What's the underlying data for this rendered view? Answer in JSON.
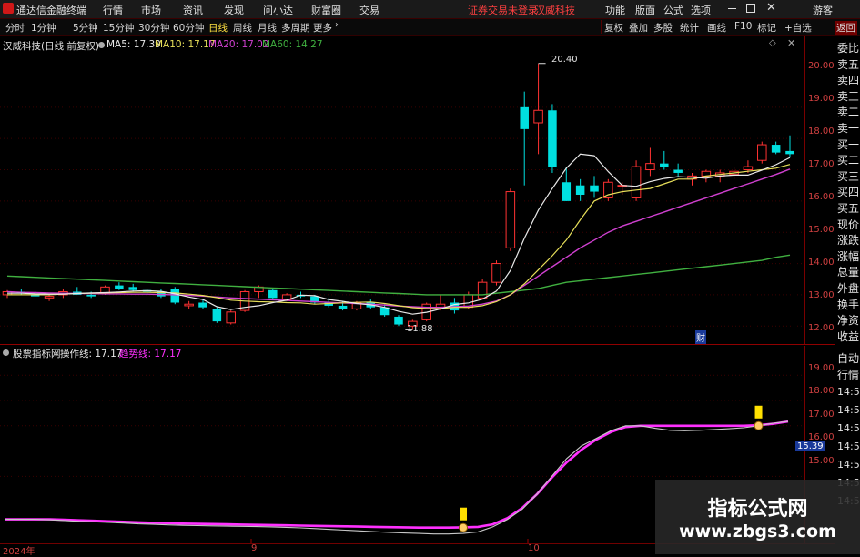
{
  "menubar": {
    "app_title": "通达信金融终端",
    "items": [
      "行情",
      "市场",
      "资讯",
      "发现",
      "问小达",
      "财富圈",
      "交易"
    ],
    "status": "证券交易未登录",
    "stock_name_top": "汉威科技",
    "right_items": [
      "功能",
      "版面",
      "公式",
      "选项"
    ],
    "guest": "游客"
  },
  "toolbar": {
    "periods": [
      "分时",
      "1分钟",
      "5分钟",
      "15分钟",
      "30分钟",
      "60分钟",
      "日线",
      "周线",
      "月线",
      "多周期",
      "更多"
    ],
    "active_period": "日线",
    "right_buttons": [
      "复权",
      "叠加",
      "多股",
      "统计",
      "画线",
      "F10",
      "标记",
      "+自选",
      "返回"
    ]
  },
  "main_chart": {
    "stock_label": "汉威科技(日线 前复权)",
    "ma5": "MA5: 17.39",
    "ma10": "MA10: 17.17",
    "ma20": "MA20: 17.02",
    "ma60": "MA60: 14.27",
    "high_label": "20.40",
    "low_label": "11.88",
    "cai_badge": "财",
    "y_ticks": [
      "20.00",
      "19.00",
      "18.00",
      "17.00",
      "16.00",
      "15.00",
      "14.00",
      "13.00",
      "12.00"
    ]
  },
  "sub_chart": {
    "name": "股票指标网",
    "op_line": "操作线: 17.17",
    "trend_line": "趋势线: 17.17",
    "current_value": "15.39",
    "y_ticks": [
      "19.00",
      "18.00",
      "17.00",
      "16.00",
      "15.00"
    ]
  },
  "side_panel": {
    "quote_items": [
      "委比",
      "卖五",
      "卖四",
      "卖三",
      "卖二",
      "卖一",
      "买一",
      "买二",
      "买三",
      "买四",
      "买五",
      "现价",
      "涨跌",
      "涨幅",
      "总量",
      "外盘",
      "换手",
      "净资",
      "收益"
    ],
    "sub_items": [
      "自动",
      "行情"
    ],
    "time_items": [
      "14:50",
      "14:50",
      "14:50",
      "14:50",
      "14:50",
      "14:50",
      "14:50"
    ]
  },
  "date_axis": {
    "labels": [
      "2024年",
      "9",
      "10"
    ]
  },
  "watermark": {
    "title": "指标公式网",
    "url": "www.zbgs3.com"
  },
  "colors": {
    "up": "#ff3232",
    "down": "#00e0e0",
    "ma5": "#e8e8e8",
    "ma10": "#e8e05a",
    "ma20": "#d040d0",
    "ma60": "#40b040",
    "trend": "#ff30ff",
    "axis": "#b02020"
  },
  "chart_data": [
    {
      "type": "candlestick",
      "title": "汉威科技(日线 前复权)",
      "candles": [
        [
          13.0,
          13.15,
          12.9,
          13.1
        ],
        [
          13.1,
          13.2,
          13.0,
          13.05
        ],
        [
          13.0,
          13.1,
          12.95,
          12.95
        ],
        [
          12.9,
          13.0,
          12.8,
          12.95
        ],
        [
          13.0,
          13.2,
          12.9,
          13.1
        ],
        [
          13.1,
          13.25,
          13.0,
          13.0
        ],
        [
          13.0,
          13.1,
          12.9,
          12.95
        ],
        [
          13.05,
          13.3,
          13.0,
          13.25
        ],
        [
          13.3,
          13.4,
          13.15,
          13.2
        ],
        [
          13.25,
          13.35,
          13.1,
          13.15
        ],
        [
          13.15,
          13.2,
          13.0,
          13.1
        ],
        [
          13.1,
          13.2,
          12.9,
          12.95
        ],
        [
          13.2,
          13.25,
          12.7,
          12.75
        ],
        [
          12.65,
          12.8,
          12.55,
          12.7
        ],
        [
          12.75,
          12.85,
          12.55,
          12.6
        ],
        [
          12.55,
          12.6,
          12.1,
          12.15
        ],
        [
          12.1,
          12.5,
          12.05,
          12.45
        ],
        [
          12.5,
          13.15,
          12.45,
          13.1
        ],
        [
          13.1,
          13.3,
          12.9,
          13.25
        ],
        [
          13.15,
          13.2,
          12.85,
          12.9
        ],
        [
          12.85,
          13.05,
          12.8,
          13.0
        ],
        [
          13.0,
          13.1,
          12.9,
          12.95
        ],
        [
          12.95,
          13.0,
          12.7,
          12.75
        ],
        [
          12.75,
          12.9,
          12.6,
          12.65
        ],
        [
          12.65,
          12.8,
          12.5,
          12.55
        ],
        [
          12.55,
          12.8,
          12.5,
          12.75
        ],
        [
          12.75,
          12.85,
          12.55,
          12.6
        ],
        [
          12.6,
          12.7,
          12.3,
          12.35
        ],
        [
          12.3,
          12.35,
          12.0,
          12.05
        ],
        [
          12.0,
          12.2,
          11.88,
          12.15
        ],
        [
          12.2,
          12.75,
          12.15,
          12.7
        ],
        [
          12.6,
          13.0,
          12.5,
          12.7
        ],
        [
          12.75,
          12.9,
          12.4,
          12.5
        ],
        [
          12.6,
          13.1,
          12.55,
          13.0
        ],
        [
          12.9,
          13.5,
          12.85,
          13.4
        ],
        [
          13.4,
          14.1,
          13.3,
          14.0
        ],
        [
          14.5,
          16.4,
          14.4,
          16.3
        ],
        [
          19.0,
          19.5,
          16.5,
          18.3
        ],
        [
          18.5,
          20.4,
          17.5,
          18.9
        ],
        [
          18.9,
          19.1,
          16.9,
          17.1
        ],
        [
          16.6,
          17.1,
          16.0,
          16.0
        ],
        [
          16.5,
          16.7,
          16.0,
          16.2
        ],
        [
          16.5,
          16.8,
          16.1,
          16.3
        ],
        [
          16.1,
          16.7,
          16.0,
          16.6
        ],
        [
          16.5,
          16.6,
          16.2,
          16.5
        ],
        [
          16.1,
          17.3,
          16.0,
          17.1
        ],
        [
          17.0,
          17.7,
          16.8,
          17.2
        ],
        [
          17.2,
          17.6,
          17.0,
          17.1
        ],
        [
          17.0,
          17.2,
          16.8,
          16.9
        ],
        [
          16.7,
          16.9,
          16.5,
          16.8
        ],
        [
          16.8,
          17.0,
          16.6,
          16.95
        ],
        [
          16.8,
          17.0,
          16.6,
          16.9
        ],
        [
          16.85,
          17.1,
          16.7,
          16.95
        ],
        [
          17.0,
          17.3,
          16.9,
          17.1
        ],
        [
          17.3,
          17.9,
          17.2,
          17.8
        ],
        [
          17.8,
          17.9,
          17.5,
          17.55
        ],
        [
          17.6,
          18.1,
          17.4,
          17.5
        ]
      ],
      "ma5": [
        13.05,
        13.05,
        13.03,
        13.02,
        13.02,
        13.04,
        13.06,
        13.07,
        13.09,
        13.12,
        13.13,
        13.11,
        13.03,
        12.93,
        12.85,
        12.62,
        12.53,
        12.6,
        12.65,
        12.75,
        12.83,
        12.99,
        12.97,
        12.85,
        12.79,
        12.72,
        12.68,
        12.6,
        12.47,
        12.38,
        12.44,
        12.55,
        12.69,
        12.74,
        12.86,
        13.12,
        13.78,
        14.81,
        15.71,
        16.4,
        17.05,
        17.5,
        17.45,
        16.94,
        16.5,
        16.47,
        16.62,
        16.72,
        16.78,
        16.76,
        16.73,
        16.8,
        16.83,
        16.83,
        16.99,
        17.16,
        17.39
      ],
      "ma10": [
        13.0,
        13.0,
        13.0,
        13.0,
        13.02,
        13.04,
        13.05,
        13.06,
        13.07,
        13.08,
        13.08,
        13.07,
        13.06,
        13.02,
        12.98,
        12.91,
        12.83,
        12.8,
        12.78,
        12.77,
        12.75,
        12.74,
        12.7,
        12.72,
        12.74,
        12.76,
        12.77,
        12.72,
        12.65,
        12.59,
        12.56,
        12.56,
        12.6,
        12.6,
        12.65,
        12.78,
        13.0,
        13.35,
        13.8,
        14.25,
        14.75,
        15.4,
        16.0,
        16.2,
        16.3,
        16.35,
        16.4,
        16.55,
        16.7,
        16.7,
        16.8,
        16.85,
        16.9,
        16.95,
        17.0,
        17.05,
        17.17
      ],
      "ma20": [
        13.1,
        13.08,
        13.07,
        13.06,
        13.05,
        13.04,
        13.04,
        13.03,
        13.03,
        13.02,
        13.02,
        13.01,
        13.0,
        12.98,
        12.96,
        12.93,
        12.9,
        12.88,
        12.86,
        12.84,
        12.82,
        12.8,
        12.78,
        12.76,
        12.74,
        12.72,
        12.7,
        12.67,
        12.64,
        12.62,
        12.6,
        12.6,
        12.62,
        12.64,
        12.7,
        12.8,
        13.0,
        13.3,
        13.6,
        13.9,
        14.2,
        14.5,
        14.75,
        15.0,
        15.2,
        15.35,
        15.5,
        15.65,
        15.8,
        15.95,
        16.1,
        16.25,
        16.4,
        16.55,
        16.7,
        16.85,
        17.02
      ],
      "ma60": [
        13.6,
        13.58,
        13.56,
        13.54,
        13.52,
        13.5,
        13.48,
        13.46,
        13.44,
        13.42,
        13.4,
        13.38,
        13.36,
        13.34,
        13.32,
        13.3,
        13.28,
        13.26,
        13.24,
        13.22,
        13.2,
        13.18,
        13.16,
        13.14,
        13.12,
        13.1,
        13.08,
        13.06,
        13.04,
        13.02,
        13.0,
        13.0,
        13.0,
        13.0,
        13.0,
        13.05,
        13.1,
        13.15,
        13.2,
        13.3,
        13.4,
        13.45,
        13.5,
        13.55,
        13.6,
        13.65,
        13.7,
        13.75,
        13.8,
        13.85,
        13.9,
        13.95,
        14.0,
        14.05,
        14.1,
        14.2,
        14.27
      ],
      "y_range": [
        11.6,
        20.8
      ]
    },
    {
      "type": "line",
      "title": "股票指标网",
      "series": [
        {
          "name": "操作线",
          "values": [
            13.3,
            13.3,
            13.3,
            13.28,
            13.25,
            13.22,
            13.2,
            13.18,
            13.15,
            13.12,
            13.1,
            13.08,
            13.06,
            13.05,
            13.04,
            13.03,
            13.02,
            13.01,
            13.0,
            12.98,
            12.96,
            12.93,
            12.9,
            12.87,
            12.84,
            12.81,
            12.78,
            12.76,
            12.74,
            12.72,
            12.72,
            12.74,
            12.8,
            13.0,
            13.3,
            13.7,
            14.3,
            15.0,
            15.7,
            16.2,
            16.5,
            16.8,
            17.0,
            17.0,
            16.9,
            16.82,
            16.8,
            16.82,
            16.85,
            16.88,
            16.92,
            17.0,
            17.1,
            17.17
          ]
        },
        {
          "name": "趋势线",
          "values": [
            13.3,
            13.3,
            13.3,
            13.3,
            13.28,
            13.26,
            13.24,
            13.22,
            13.2,
            13.18,
            13.16,
            13.15,
            13.13,
            13.12,
            13.11,
            13.1,
            13.09,
            13.08,
            13.07,
            13.06,
            13.05,
            13.04,
            13.03,
            13.02,
            13.01,
            13.0,
            12.99,
            12.98,
            12.97,
            12.97,
            12.97,
            12.98,
            13.0,
            13.1,
            13.35,
            13.75,
            14.3,
            14.95,
            15.55,
            16.05,
            16.45,
            16.75,
            16.95,
            17.0,
            17.0,
            17.0,
            17.0,
            17.0,
            17.0,
            17.0,
            17.0,
            17.02,
            17.08,
            17.17
          ]
        }
      ],
      "y_range": [
        12.6,
        19.8
      ]
    }
  ]
}
